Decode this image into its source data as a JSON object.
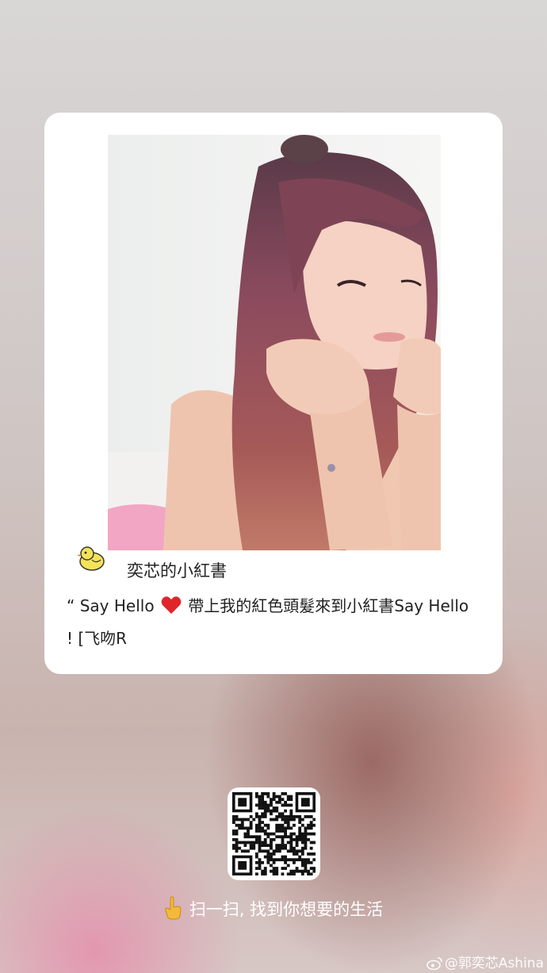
{
  "card": {
    "username": "奕芯的小紅書",
    "caption_before_heart": "“ Say Hello ",
    "caption_after_heart": " 帶上我的紅色頭髮來到小紅書Say Hello ! [飞吻R",
    "heart_icon": "heart-icon",
    "avatar_icon": "duck-avatar-icon",
    "accent_color": "#e0242b"
  },
  "qr": {
    "icon": "qr-code-icon"
  },
  "footer": {
    "scan_text": "扫一扫, 找到你想要的生活",
    "hand_icon": "pointing-hand-icon"
  },
  "watermark": {
    "text": "@郭奕芯Ashina",
    "icon": "weibo-icon"
  }
}
